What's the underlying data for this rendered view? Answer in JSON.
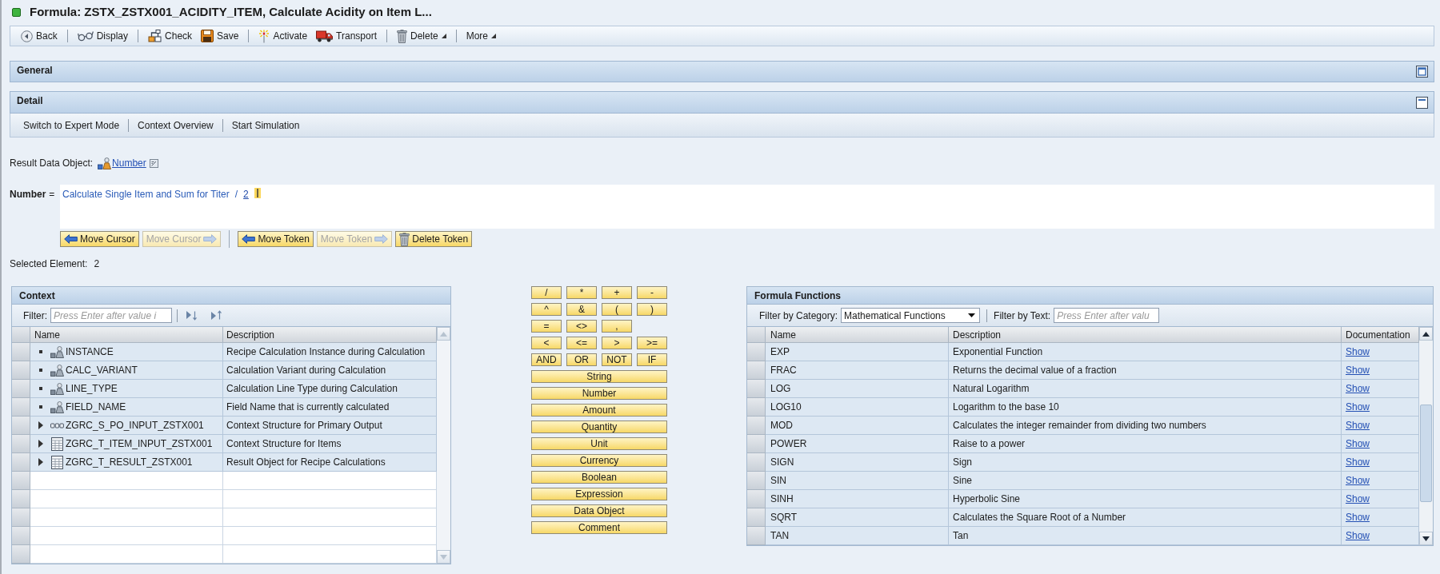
{
  "window": {
    "title": "Formula: ZSTX_ZSTX001_ACIDITY_ITEM, Calculate Acidity on Item L..."
  },
  "toolbar": [
    [
      {
        "label": "Back",
        "kind": "back",
        "menu": false
      }
    ],
    [
      {
        "label": "Display",
        "kind": "display",
        "menu": false
      }
    ],
    [
      {
        "label": "Check",
        "kind": "check",
        "menu": false
      },
      {
        "label": "Save",
        "kind": "save",
        "menu": false
      }
    ],
    [
      {
        "label": "Activate",
        "kind": "activate",
        "menu": false
      },
      {
        "label": "Transport",
        "kind": "transport",
        "menu": false
      }
    ],
    [
      {
        "label": "Delete",
        "kind": "delete",
        "menu": true
      }
    ],
    [
      {
        "label": "More",
        "kind": "text",
        "menu": true
      }
    ]
  ],
  "panels": [
    {
      "title": "General",
      "expanded": false
    },
    {
      "title": "Detail",
      "expanded": true,
      "links": [
        "Switch to Expert Mode",
        "Context Overview",
        "Start Simulation"
      ]
    }
  ],
  "result_data_object": {
    "label": "Result Data Object:",
    "value": "Number"
  },
  "formula": {
    "target": "Number",
    "equals": "=",
    "tokens": [
      {
        "text": "Calculate Single Item and Sum for Titer",
        "selected": false
      },
      {
        "text": "/",
        "selected": false
      },
      {
        "text": "2",
        "selected": true
      }
    ]
  },
  "token_buttons": [
    [
      {
        "label": "Move Cursor",
        "kind": "left",
        "disabled": false
      },
      {
        "label": "Move Cursor",
        "kind": "right",
        "disabled": true
      }
    ],
    [
      {
        "label": "Move Token",
        "kind": "left",
        "disabled": false
      },
      {
        "label": "Move Token",
        "kind": "right",
        "disabled": true
      },
      {
        "label": "Delete Token",
        "kind": "delete",
        "disabled": false
      }
    ]
  ],
  "selected_element": {
    "label": "Selected Element:",
    "value": "2"
  },
  "context": {
    "title": "Context",
    "filter": {
      "label": "Filter:",
      "placeholder": "Press Enter after value i"
    },
    "columns": [
      "Name",
      "Description"
    ],
    "rows": [
      {
        "name": "INSTANCE",
        "description": "Recipe Calculation Instance during Calculation",
        "kind": "element",
        "leaf": true
      },
      {
        "name": "CALC_VARIANT",
        "description": "Calculation Variant during Calculation",
        "kind": "element",
        "leaf": true
      },
      {
        "name": "LINE_TYPE",
        "description": "Calculation Line Type during Calculation",
        "kind": "element",
        "leaf": true
      },
      {
        "name": "FIELD_NAME",
        "description": "Field Name that is currently calculated",
        "kind": "element",
        "leaf": true
      },
      {
        "name": "ZGRC_S_PO_INPUT_ZSTX001",
        "description": "Context Structure for Primary Output",
        "kind": "structure",
        "leaf": false
      },
      {
        "name": "ZGRC_T_ITEM_INPUT_ZSTX001",
        "description": "Context Structure for Items",
        "kind": "table",
        "leaf": false
      },
      {
        "name": "ZGRC_T_RESULT_ZSTX001",
        "description": "Result Object for Recipe Calculations",
        "kind": "table",
        "leaf": false
      }
    ]
  },
  "operators": {
    "rows": [
      [
        "/",
        "*",
        "+",
        "-"
      ],
      [
        "^",
        "&",
        "(",
        ")"
      ],
      [
        "=",
        "<>",
        ","
      ],
      [
        "<",
        "<=",
        ">",
        ">="
      ],
      [
        "AND",
        "OR",
        "NOT",
        "IF"
      ]
    ],
    "types": [
      "String",
      "Number",
      "Amount",
      "Quantity",
      "Unit",
      "Currency",
      "Boolean",
      "Expression",
      "Data Object",
      "Comment"
    ]
  },
  "formula_functions": {
    "title": "Formula Functions",
    "category_filter": {
      "label": "Filter by Category:",
      "value": "Mathematical Functions"
    },
    "text_filter": {
      "label": "Filter by Text:",
      "placeholder": "Press Enter after valu"
    },
    "columns": [
      "Name",
      "Description",
      "Documentation"
    ],
    "rows": [
      {
        "name": "EXP",
        "description": "Exponential Function",
        "documentation": "Show"
      },
      {
        "name": "FRAC",
        "description": "Returns the decimal value of a fraction",
        "documentation": "Show"
      },
      {
        "name": "LOG",
        "description": "Natural Logarithm",
        "documentation": "Show"
      },
      {
        "name": "LOG10",
        "description": "Logarithm to the base 10",
        "documentation": "Show"
      },
      {
        "name": "MOD",
        "description": "Calculates the integer remainder from dividing two numbers",
        "documentation": "Show"
      },
      {
        "name": "POWER",
        "description": "Raise to a power",
        "documentation": "Show"
      },
      {
        "name": "SIGN",
        "description": "Sign",
        "documentation": "Show"
      },
      {
        "name": "SIN",
        "description": "Sine",
        "documentation": "Show"
      },
      {
        "name": "SINH",
        "description": "Hyperbolic Sine",
        "documentation": "Show"
      },
      {
        "name": "SQRT",
        "description": "Calculates the Square Root of a Number",
        "documentation": "Show"
      },
      {
        "name": "TAN",
        "description": "Tan",
        "documentation": "Show"
      }
    ]
  }
}
